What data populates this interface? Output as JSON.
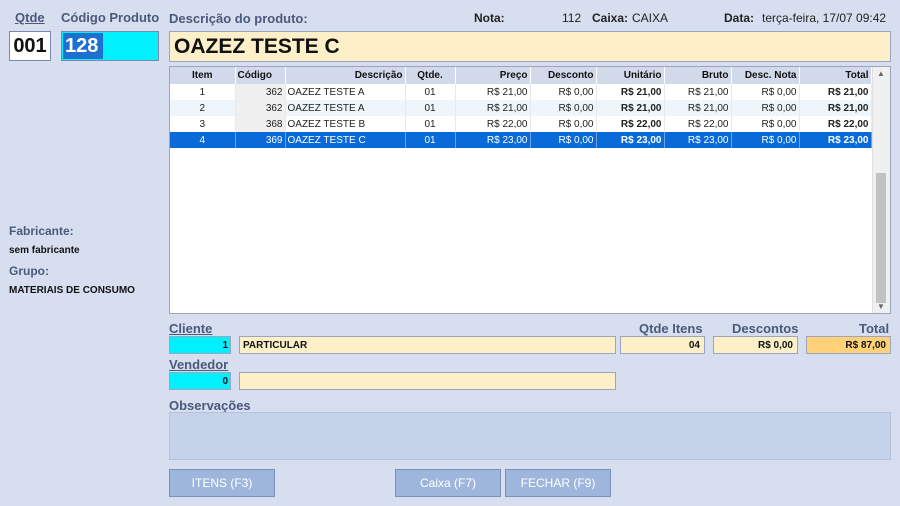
{
  "header": {
    "qtde_label": "Qtde",
    "codigo_label": "Código Produto",
    "qtde_value": "001",
    "codigo_value": "128",
    "descricao_label": "Descrição do produto:",
    "nota_label": "Nota:",
    "nota_value": "112",
    "caixa_label": "Caixa:",
    "caixa_value": "CAIXA",
    "data_label": "Data:",
    "data_value": "terça-feira, 17/07 09:42",
    "descricao_value": "OAZEZ TESTE C"
  },
  "side": {
    "fabricante_label": "Fabricante:",
    "fabricante_value": "sem fabricante",
    "grupo_label": "Grupo:",
    "grupo_value": "MATERIAIS DE CONSUMO"
  },
  "grid": {
    "columns": [
      "Item",
      "Código",
      "Descrição",
      "Qtde.",
      "Preço",
      "Desconto",
      "Unitário",
      "Bruto",
      "Desc. Nota",
      "Total"
    ],
    "rows": [
      {
        "item": "1",
        "codigo": "362",
        "descricao": "OAZEZ TESTE A",
        "qtde": "01",
        "preco": "R$ 21,00",
        "desconto": "R$ 0,00",
        "unitario": "R$ 21,00",
        "bruto": "R$ 21,00",
        "desc_nota": "R$ 0,00",
        "total": "R$ 21,00"
      },
      {
        "item": "2",
        "codigo": "362",
        "descricao": "OAZEZ TESTE A",
        "qtde": "01",
        "preco": "R$ 21,00",
        "desconto": "R$ 0,00",
        "unitario": "R$ 21,00",
        "bruto": "R$ 21,00",
        "desc_nota": "R$ 0,00",
        "total": "R$ 21,00"
      },
      {
        "item": "3",
        "codigo": "368",
        "descricao": "OAZEZ TESTE B",
        "qtde": "01",
        "preco": "R$ 22,00",
        "desconto": "R$ 0,00",
        "unitario": "R$ 22,00",
        "bruto": "R$ 22,00",
        "desc_nota": "R$ 0,00",
        "total": "R$ 22,00"
      },
      {
        "item": "4",
        "codigo": "369",
        "descricao": "OAZEZ TESTE C",
        "qtde": "01",
        "preco": "R$ 23,00",
        "desconto": "R$ 0,00",
        "unitario": "R$ 23,00",
        "bruto": "R$ 23,00",
        "desc_nota": "R$ 0,00",
        "total": "R$ 23,00"
      }
    ],
    "selected_row": 3,
    "scroll_up_icon": "triangle-up",
    "scroll_down_icon": "triangle-down"
  },
  "footer": {
    "cliente_label": "Cliente",
    "cliente_id": "1",
    "cliente_nome": "PARTICULAR",
    "qtde_itens_label": "Qtde Itens",
    "qtde_itens_value": "04",
    "descontos_label": "Descontos",
    "descontos_value": "R$ 0,00",
    "total_label": "Total",
    "total_value": "R$ 87,00",
    "vendedor_label": "Vendedor",
    "vendedor_id": "0",
    "vendedor_nome": "",
    "observacoes_label": "Observações"
  },
  "buttons": {
    "itens": "ITENS (F3)",
    "caixa": "Caixa (F7)",
    "fechar": "FECHAR (F9)"
  },
  "colors": {
    "background": "#d6deef",
    "cyan_field": "#00f0ff",
    "selected_row": "#0a6ad8",
    "input_yellow": "#fdf0c8",
    "total_highlight": "#ffd27a",
    "button": "#9fb6dc"
  }
}
